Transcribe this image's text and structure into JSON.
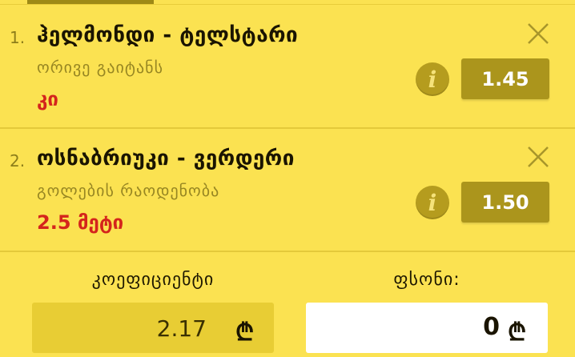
{
  "bets": [
    {
      "number": "1.",
      "title": "ჰელმონდი - ტელსტარი",
      "market": "ორივე გაიტანს",
      "outcome": "კი",
      "odds": "1.45"
    },
    {
      "number": "2.",
      "title": "ოსნაბრიუკი - ვერდერი",
      "market": "გოლების რაოდენობა",
      "outcome": "2.5 მეტი",
      "odds": "1.50"
    }
  ],
  "icons": {
    "close": "close-icon",
    "info": "info-icon",
    "currency": "lari-icon"
  },
  "info_glyph": "i",
  "footer": {
    "coefficient_label": "კოეფიციენტი",
    "coefficient_value": "2.17",
    "stake_label": "ფსონი:",
    "stake_value": "0",
    "currency_symbol": "₾"
  },
  "colors": {
    "background": "#fbe251",
    "odds_button": "#ab951c",
    "info_button": "#b59c1e",
    "outcome_text": "#d4241c",
    "coefficient_box": "#e8cd34"
  }
}
